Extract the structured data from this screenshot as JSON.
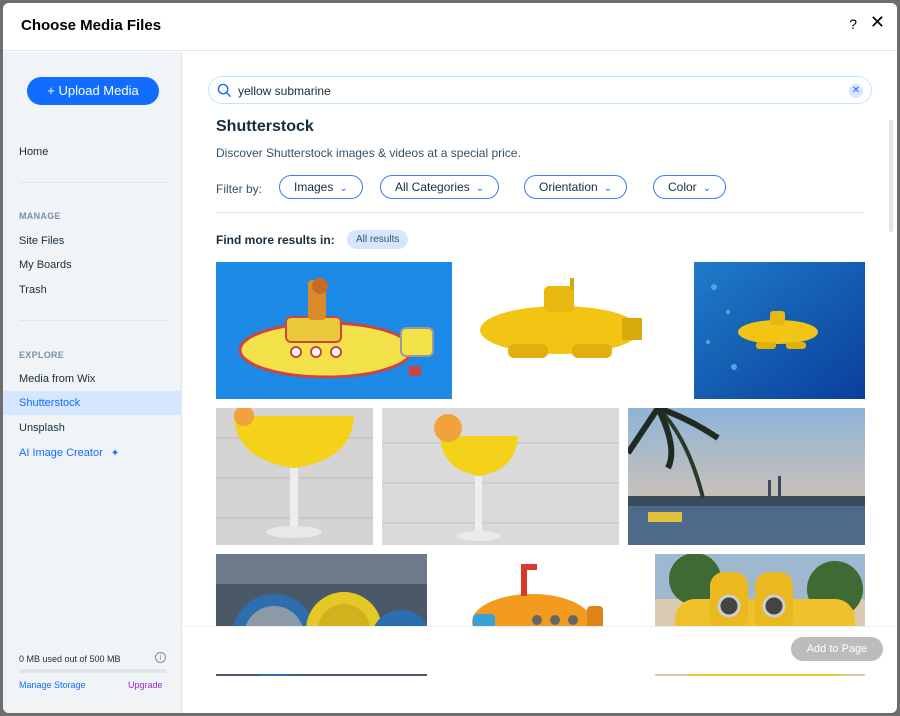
{
  "dialog": {
    "title": "Choose Media Files",
    "help_label": "?",
    "close_label": "✕"
  },
  "sidebar": {
    "upload_label": "+ Upload Media",
    "home": "Home",
    "manage_heading": "MANAGE",
    "manage_items": [
      "Site Files",
      "My Boards",
      "Trash"
    ],
    "explore_heading": "EXPLORE",
    "explore_items": [
      "Media from Wix",
      "Shutterstock",
      "Unsplash",
      "AI Image Creator"
    ],
    "active_item": "Shutterstock",
    "storage_text": "0 MB used out of 500 MB",
    "storage_fraction": 0.0,
    "manage_storage": "Manage Storage",
    "upgrade": "Upgrade"
  },
  "search": {
    "value": "yellow submarine",
    "placeholder": "Search"
  },
  "main": {
    "heading": "Shutterstock",
    "subtitle": "Discover Shutterstock images & videos at a special price.",
    "filter_label": "Filter by:",
    "filters": [
      "Images",
      "All Categories",
      "Orientation",
      "Color"
    ],
    "more_results_label": "Find more results in:",
    "more_results_badge": "All results"
  },
  "results": [
    {
      "name": "yellow-submarine-cartoon",
      "bg": "#1c8ae6"
    },
    {
      "name": "yellow-submarine-3d",
      "bg": "#ffffff"
    },
    {
      "name": "yellow-submarine-underwater",
      "bg": "#0b5fb5"
    },
    {
      "name": "cocktail-glass-1",
      "bg": "#d9d9d9"
    },
    {
      "name": "cocktail-glass-2",
      "bg": "#dcdcdc"
    },
    {
      "name": "harbor-sunset",
      "bg": "#8da9c9"
    },
    {
      "name": "cable-reels",
      "bg": "#4a5868"
    },
    {
      "name": "toy-submarine",
      "bg": "#ffffff"
    },
    {
      "name": "yellow-submarine-park",
      "bg": "#e3c57a"
    }
  ],
  "footer": {
    "add_label": "Add to Page"
  },
  "colors": {
    "accent": "#116dff",
    "sidebar_bg": "#f0f4f7",
    "active_bg": "#d6e6fe",
    "upgrade": "#9a27d5"
  }
}
